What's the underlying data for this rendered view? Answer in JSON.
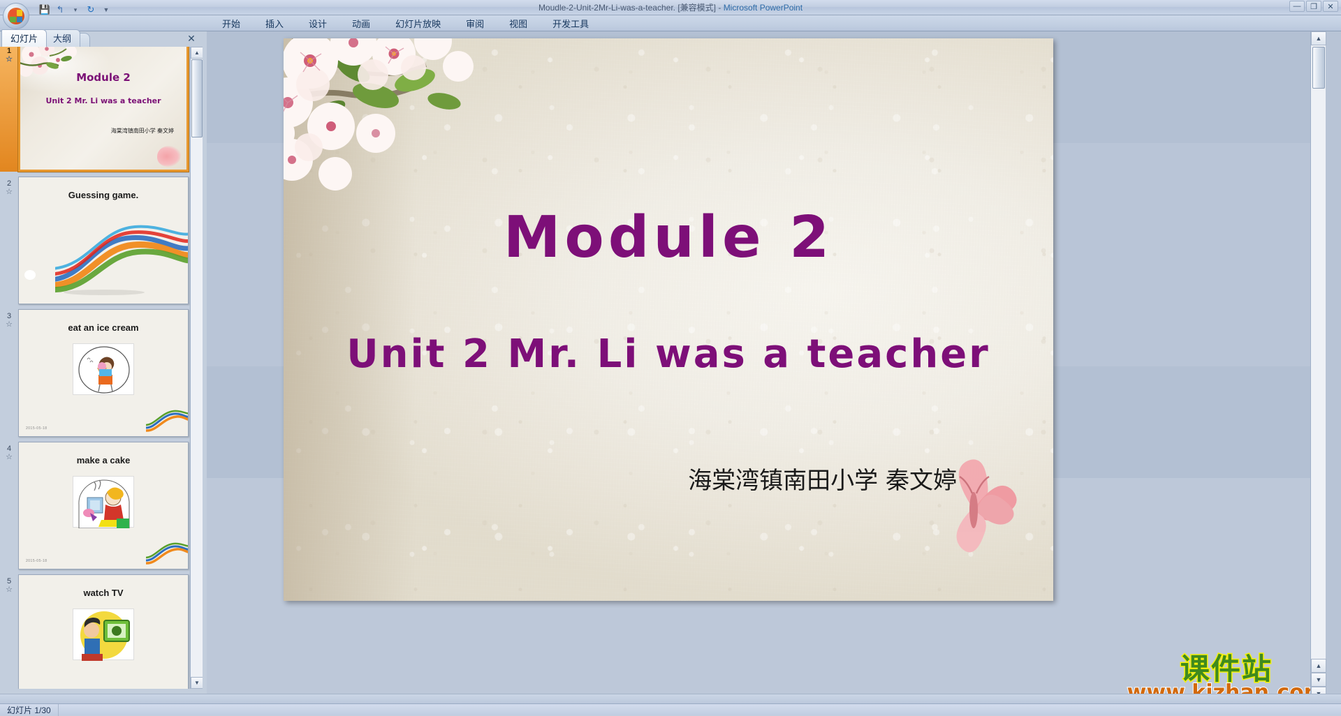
{
  "window": {
    "title": "Moudle-2-Unit-2Mr-Li-was-a-teacher. [兼容模式]",
    "separator": " - ",
    "app_name": "Microsoft PowerPoint",
    "minimize": "—",
    "restore": "❐",
    "close": "✕"
  },
  "quick_access": {
    "save": "💾",
    "undo": "↰",
    "undo_drop": "▾",
    "redo": "↻",
    "more": "▼"
  },
  "ribbon": {
    "tabs": [
      {
        "label": "开始"
      },
      {
        "label": "插入"
      },
      {
        "label": "设计"
      },
      {
        "label": "动画"
      },
      {
        "label": "幻灯片放映"
      },
      {
        "label": "审阅"
      },
      {
        "label": "视图"
      },
      {
        "label": "开发工具"
      }
    ]
  },
  "left_pane": {
    "tabs": [
      {
        "label": "幻灯片",
        "active": true
      },
      {
        "label": "大纲",
        "active": false
      }
    ],
    "close_label": "✕",
    "scroll_up": "▲",
    "scroll_down": "▼",
    "thumbnails": [
      {
        "number": "1",
        "title": "Module 2",
        "subtitle": "Unit 2 Mr. Li was a teacher",
        "author": "海棠湾镇南田小学 秦文婷",
        "selected": true
      },
      {
        "number": "2",
        "title": "Guessing game.",
        "selected": false
      },
      {
        "number": "3",
        "title": "eat an ice cream",
        "selected": false
      },
      {
        "number": "4",
        "title": "make a cake",
        "selected": false
      },
      {
        "number": "5",
        "title": "watch TV",
        "selected": false
      }
    ]
  },
  "slide": {
    "title": "Module 2",
    "subtitle": "Unit 2 Mr. Li was a teacher",
    "author": "海棠湾镇南田小学 秦文婷",
    "title_color": "#7d0f78",
    "background_color": "#f1efe8",
    "watermark_cn": "课件站",
    "watermark_url": "www.kjzhan.com",
    "watermark_cn_color": "#3f8a1e",
    "watermark_url_color": "#d2690c"
  },
  "stage": {
    "scroll_up": "▲",
    "scroll_down": "▼",
    "prev_slide": "▲",
    "next_slide": "▼"
  },
  "status_bar": {
    "slide_counter": "幻灯片 1/30"
  }
}
